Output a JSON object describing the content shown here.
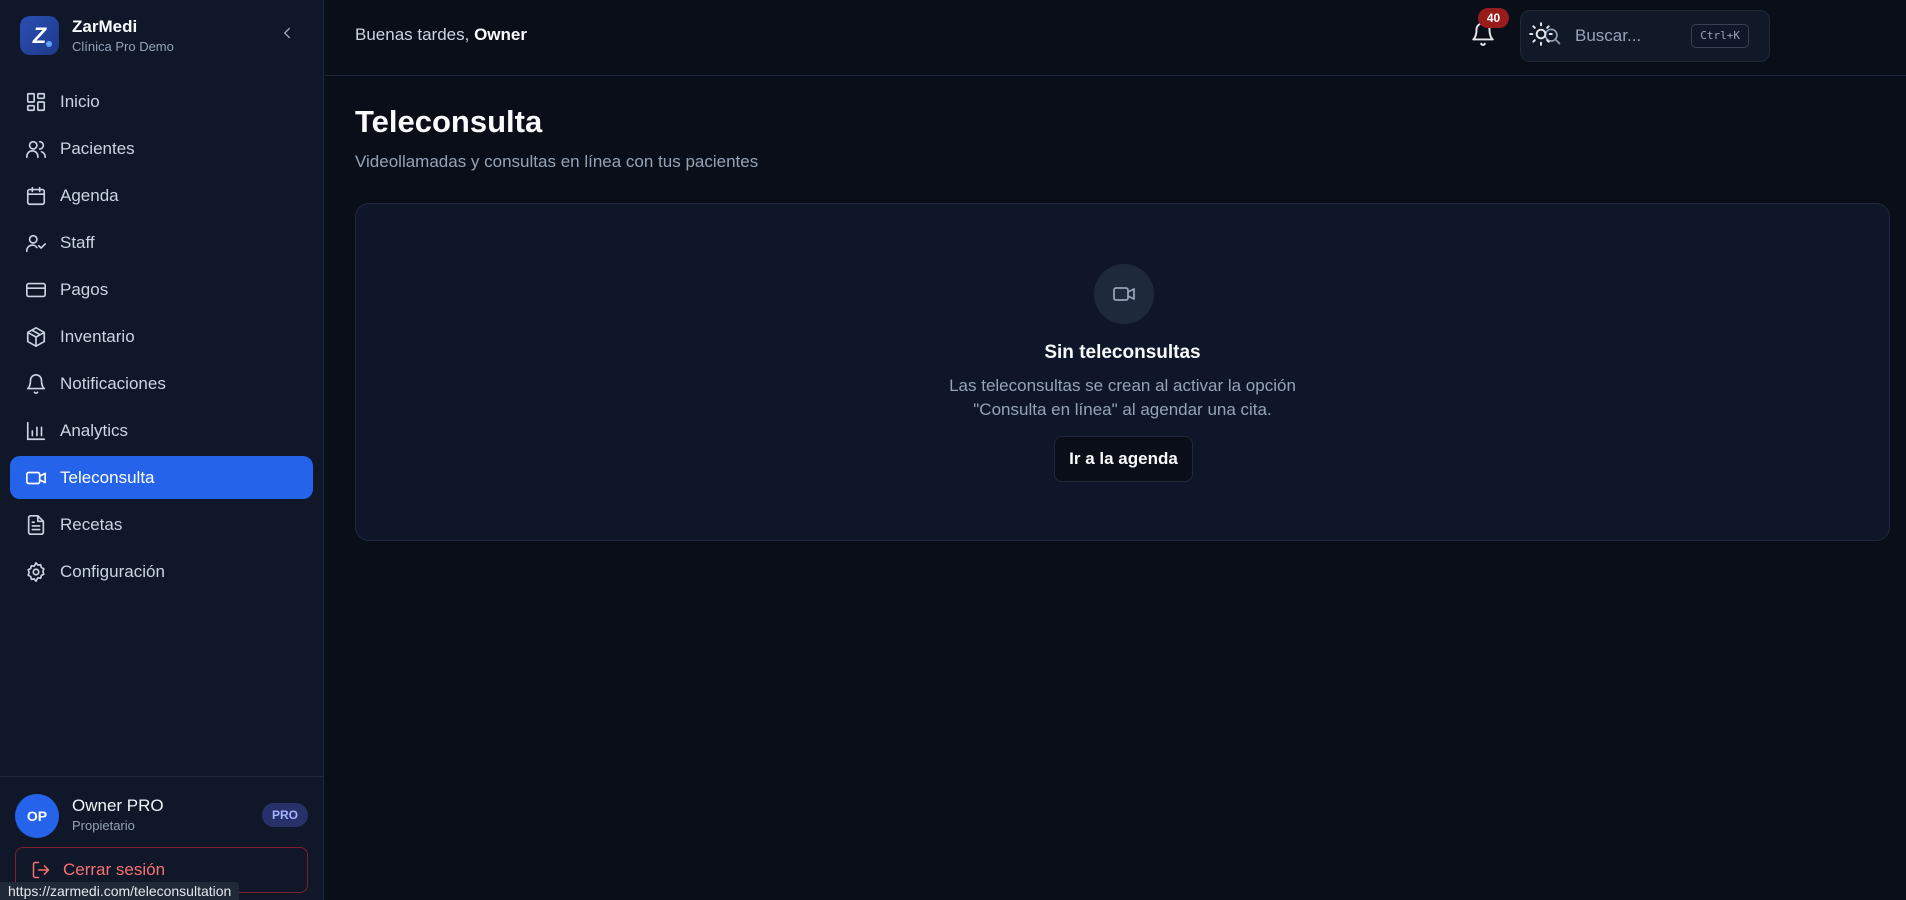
{
  "brand": {
    "name": "ZarMedi",
    "subtitle": "Clínica Pro Demo",
    "logo_letter": "Z"
  },
  "sidebar": {
    "items": [
      {
        "label": "Inicio",
        "icon": "dashboard-icon"
      },
      {
        "label": "Pacientes",
        "icon": "users-icon"
      },
      {
        "label": "Agenda",
        "icon": "calendar-icon"
      },
      {
        "label": "Staff",
        "icon": "user-check-icon"
      },
      {
        "label": "Pagos",
        "icon": "credit-card-icon"
      },
      {
        "label": "Inventario",
        "icon": "package-icon"
      },
      {
        "label": "Notificaciones",
        "icon": "bell-icon"
      },
      {
        "label": "Analytics",
        "icon": "bar-chart-icon"
      },
      {
        "label": "Teleconsulta",
        "icon": "video-icon",
        "active": true
      },
      {
        "label": "Recetas",
        "icon": "file-text-icon"
      },
      {
        "label": "Configuración",
        "icon": "settings-icon"
      }
    ]
  },
  "user": {
    "initials": "OP",
    "name": "Owner PRO",
    "role": "Propietario",
    "plan_badge": "PRO"
  },
  "logout": {
    "label": "Cerrar sesión"
  },
  "status_bar": {
    "url": "https://zarmedi.com/teleconsultation"
  },
  "header": {
    "greeting": "Buenas tardes, ",
    "user_name": "Owner",
    "search_placeholder": "Buscar...",
    "search_shortcut": "Ctrl+K",
    "notification_count": "40"
  },
  "page": {
    "title": "Teleconsulta",
    "subtitle": "Videollamadas y consultas en línea con tus pacientes"
  },
  "empty_state": {
    "title": "Sin teleconsultas",
    "line1": "Las teleconsultas se crean al activar la opción",
    "line2": "\"Consulta en línea\" al agendar una cita.",
    "button": "Ir a la agenda"
  },
  "colors": {
    "accent": "#2563eb",
    "background": "#0a0e18",
    "sidebar": "#0f1729",
    "danger": "#f87171"
  }
}
